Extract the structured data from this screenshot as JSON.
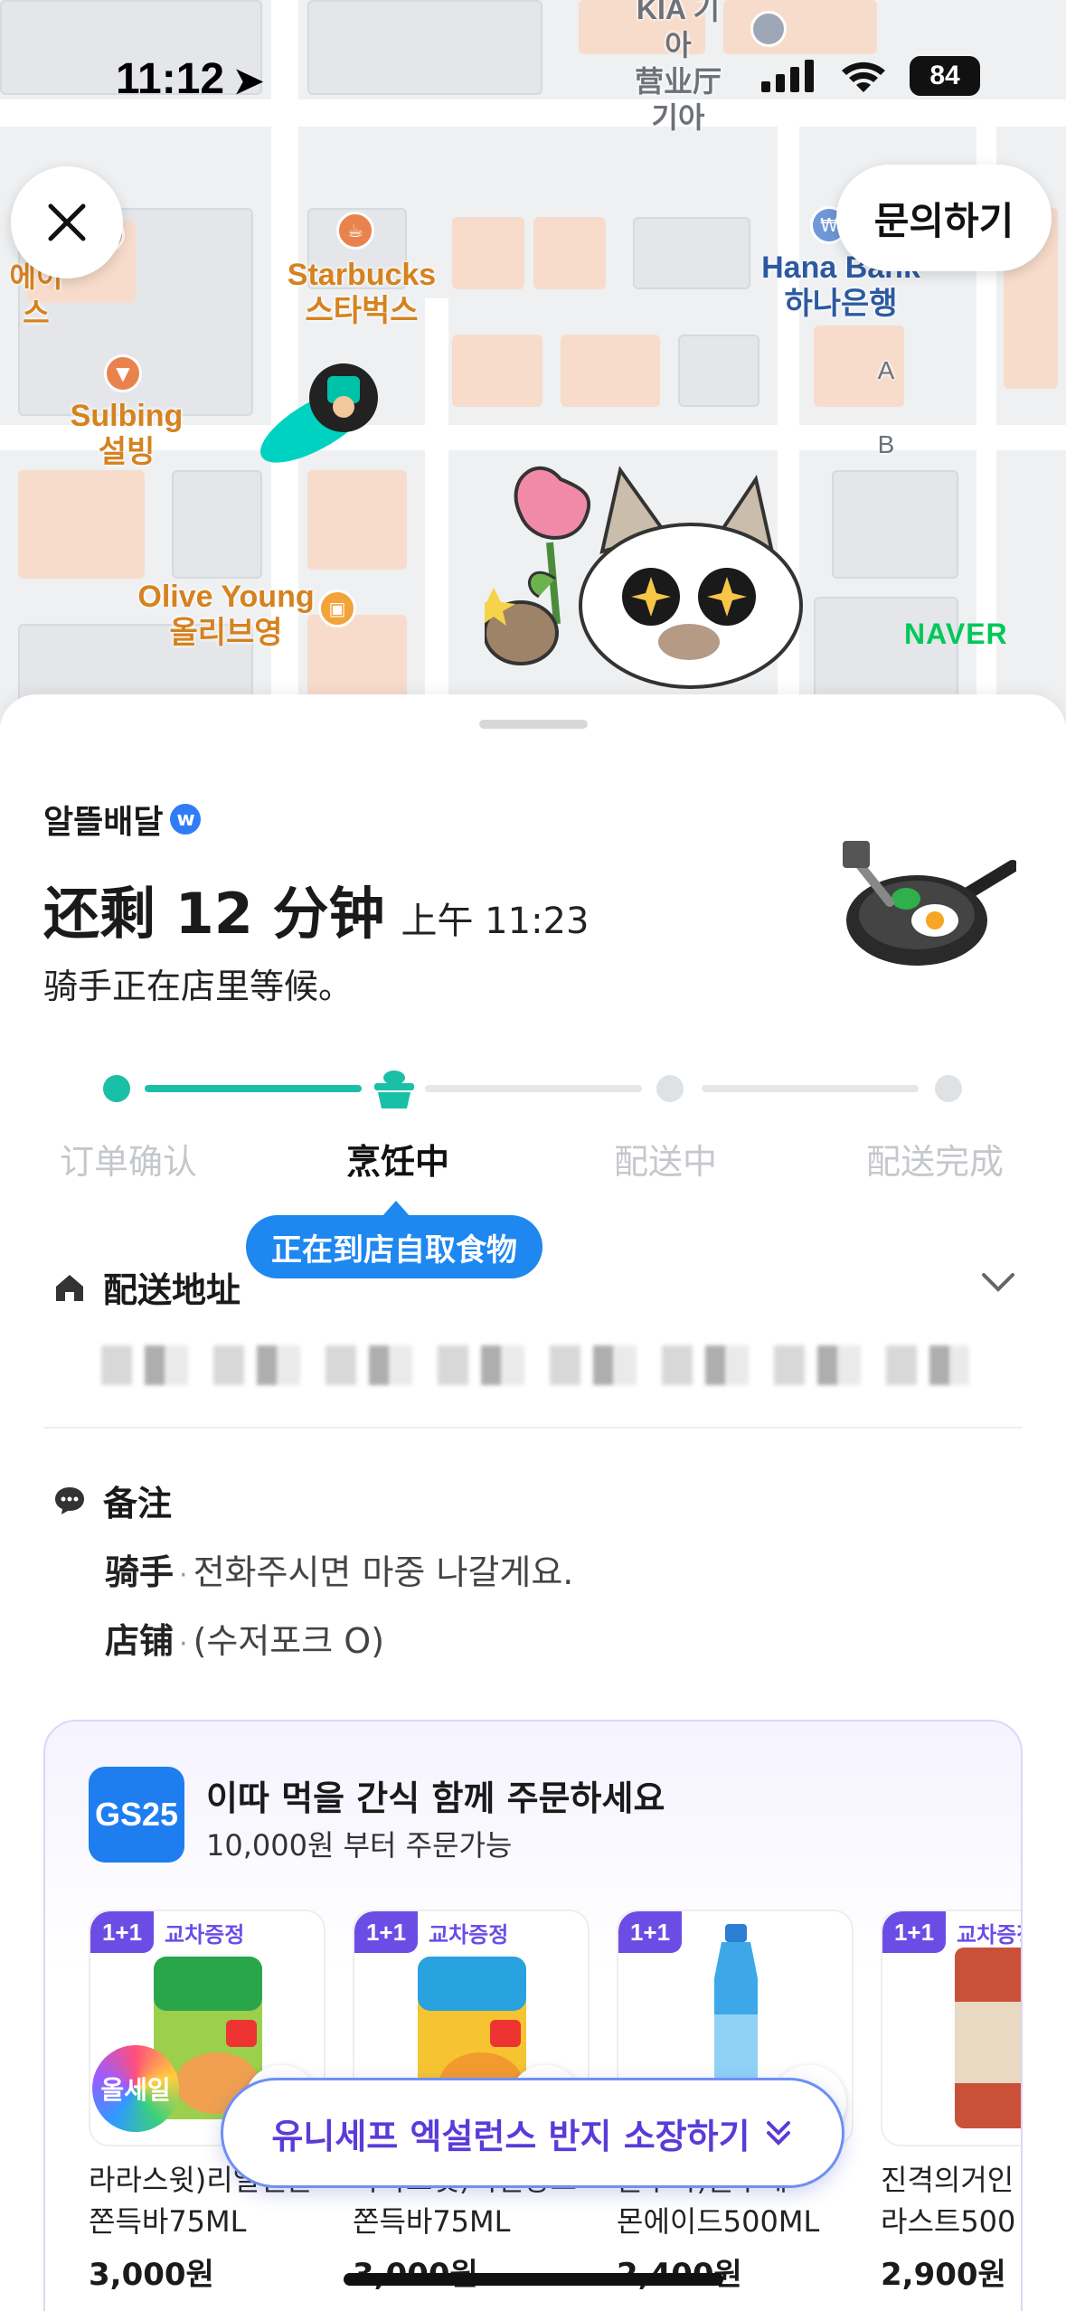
{
  "status_bar": {
    "time": "11:12",
    "battery": "84"
  },
  "map": {
    "inquiry_button": "문의하기",
    "naver_logo": "NAVER",
    "pois": [
      {
        "name": "Starbucks\n스타벅스"
      },
      {
        "name": "Hana Bank\n하나은행"
      },
      {
        "name": "Sulbing\n설빙"
      },
      {
        "name": "Olive Young\n올리브영"
      },
      {
        "name": "KIA 기아\n营业厅\n기아"
      },
      {
        "name": "A"
      },
      {
        "name": "B"
      },
      {
        "name": "에이스"
      }
    ]
  },
  "order": {
    "brand": "알뜰배달",
    "eta_main": "还剩 12 分钟",
    "eta_time": "上午 11:23",
    "eta_sub": "骑手正在店里等候。",
    "steps": [
      {
        "label": "订单确认",
        "state": "done"
      },
      {
        "label": "烹饪中",
        "state": "active"
      },
      {
        "label": "配送中",
        "state": "pending"
      },
      {
        "label": "配送完成",
        "state": "pending"
      }
    ],
    "tooltip": "正在到店自取食物",
    "address_title": "配送地址",
    "memo_title": "备注",
    "memo": [
      {
        "key": "骑手",
        "value": "전화주시면 마중 나갈게요."
      },
      {
        "key": "店铺",
        "value": "(수저포크 O)"
      }
    ]
  },
  "promo": {
    "logo": "GS25",
    "title": "이따 먹을 간식 함께 주문하세요",
    "subtitle": "10,000원 부터 주문가능",
    "badge_11": "1+1",
    "gift_label": "교차증정",
    "sale_badge": "올세일",
    "products": [
      {
        "name": "라라스윗)리얼멜론",
        "name2": "쫀득바75ML",
        "price": "3,000원",
        "gift": true
      },
      {
        "name": "라라스윗)리얼망고",
        "name2": "쫀득바75ML",
        "price": "3,000원",
        "gift": true
      },
      {
        "name": "블루톡)블루레",
        "name2": "몬에이드500ML",
        "price": "2,400원",
        "gift": false
      },
      {
        "name": "진격의거인",
        "name2": "라스트500",
        "price": "2,900원",
        "gift": true
      }
    ],
    "floating_button": "유니세프 엑설런스 반지 소장하기"
  }
}
